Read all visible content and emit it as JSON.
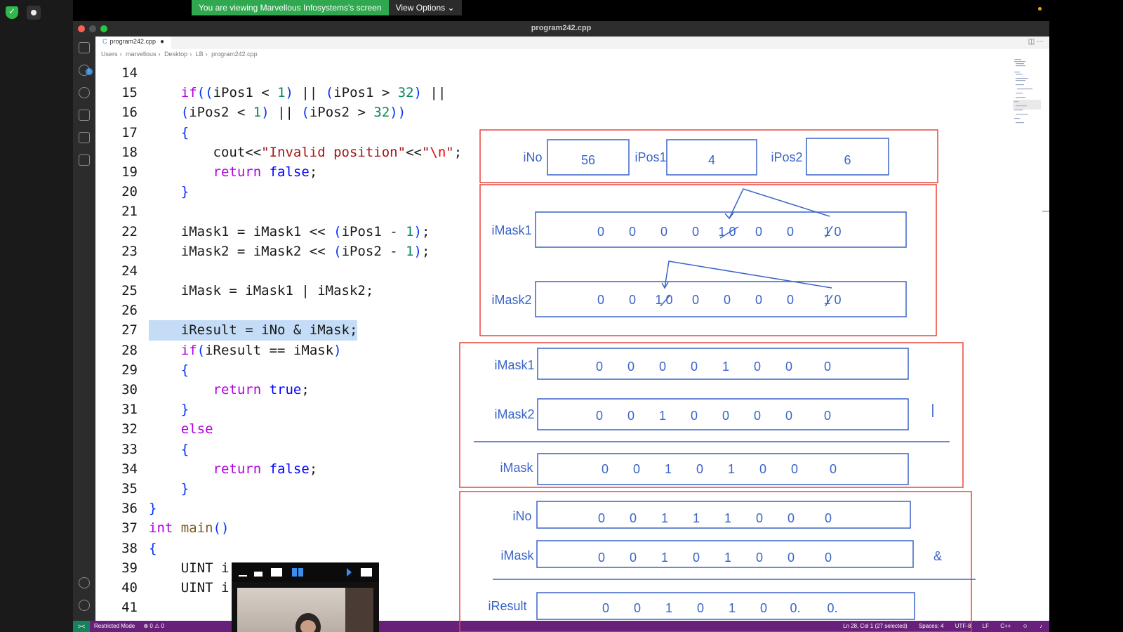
{
  "zoom": {
    "banner_text": "You are viewing Marvellous Infosystems's screen",
    "view_options": "View Options"
  },
  "window": {
    "title": "program242.cpp"
  },
  "tab": {
    "label": "program242.cpp"
  },
  "breadcrumb": [
    "Users",
    "marvellous",
    "Desktop",
    "LB",
    "program242.cpp"
  ],
  "code_lines": [
    {
      "n": "14",
      "t": ""
    },
    {
      "n": "15",
      "t": "    if((iPos1 < 1) || (iPos1 > 32) ||"
    },
    {
      "n": "16",
      "t": "    (iPos2 < 1) || (iPos2 > 32))"
    },
    {
      "n": "17",
      "t": "    {"
    },
    {
      "n": "18",
      "t": "        cout<<\"Invalid position\"<<\"\\n\";"
    },
    {
      "n": "19",
      "t": "        return false;"
    },
    {
      "n": "20",
      "t": "    }"
    },
    {
      "n": "21",
      "t": ""
    },
    {
      "n": "22",
      "t": "    iMask1 = iMask1 << (iPos1 - 1);"
    },
    {
      "n": "23",
      "t": "    iMask2 = iMask2 << (iPos2 - 1);"
    },
    {
      "n": "24",
      "t": ""
    },
    {
      "n": "25",
      "t": "    iMask = iMask1 | iMask2;"
    },
    {
      "n": "26",
      "t": ""
    },
    {
      "n": "27",
      "t": "    iResult = iNo & iMask;"
    },
    {
      "n": "28",
      "t": "    if(iResult == iMask)"
    },
    {
      "n": "29",
      "t": "    {"
    },
    {
      "n": "30",
      "t": "        return true;"
    },
    {
      "n": "31",
      "t": "    }"
    },
    {
      "n": "32",
      "t": "    else"
    },
    {
      "n": "33",
      "t": "    {"
    },
    {
      "n": "34",
      "t": "        return false;"
    },
    {
      "n": "35",
      "t": "    }"
    },
    {
      "n": "36",
      "t": "}"
    },
    {
      "n": "37",
      "t": "int main()"
    },
    {
      "n": "38",
      "t": "{"
    },
    {
      "n": "39",
      "t": "    UINT i"
    },
    {
      "n": "40",
      "t": "    UINT i                ;"
    },
    {
      "n": "41",
      "t": ""
    }
  ],
  "statusbar": {
    "restricted": "Restricted Mode",
    "problems": "⊗ 0 ⚠ 0",
    "position": "Ln 28, Col 1 (27 selected)",
    "spaces": "Spaces: 4",
    "encoding": "UTF-8",
    "eol": "LF",
    "language": "C++"
  },
  "drawing": {
    "inputs": [
      {
        "label": "iNo",
        "value": "56"
      },
      {
        "label": "iPos1",
        "value": "4"
      },
      {
        "label": "iPos2",
        "value": "6"
      }
    ],
    "shift_rows": [
      {
        "label": "iMask1",
        "bits": [
          "0",
          "0",
          "0",
          "0",
          "1 0",
          "0",
          "0",
          "1 0"
        ]
      },
      {
        "label": "iMask2",
        "bits": [
          "0",
          "0",
          "1 0",
          "0",
          "0",
          "0",
          "0",
          "1 0"
        ]
      }
    ],
    "or_rows": [
      {
        "label": "iMask1",
        "bits": [
          "0",
          "0",
          "0",
          "0",
          "1",
          "0",
          "0",
          "0"
        ]
      },
      {
        "label": "iMask2",
        "bits": [
          "0",
          "0",
          "1",
          "0",
          "0",
          "0",
          "0",
          "0"
        ]
      },
      {
        "label": "iMask",
        "bits": [
          "0",
          "0",
          "1",
          "0",
          "1",
          "0",
          "0",
          "0"
        ]
      }
    ],
    "or_op": "|",
    "and_rows": [
      {
        "label": "iNo",
        "bits": [
          "0",
          "0",
          "1",
          "1",
          "1",
          "0",
          "0",
          "0"
        ]
      },
      {
        "label": "iMask",
        "bits": [
          "0",
          "0",
          "1",
          "0",
          "1",
          "0",
          "0",
          "0"
        ]
      },
      {
        "label": "iResult",
        "bits": [
          "0",
          "0",
          "1",
          "0",
          "1",
          "0",
          "0.",
          "0."
        ]
      }
    ],
    "and_op": "&"
  }
}
